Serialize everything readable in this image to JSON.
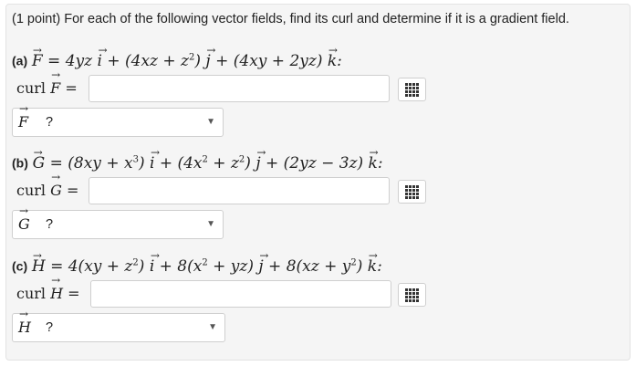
{
  "intro": "(1 point) For each of the following vector fields, find its curl and determine if it is a gradient field.",
  "curl_word": "curl",
  "parts": [
    {
      "label": "(a)",
      "field": "F",
      "expr_html": "<span class=\"vec\">F</span> = 4yz <span class=\"vec\">i</span> + (4xz + z<span class=\"up\">2</span>) <span class=\"vec\">j</span> + (4xy + 2yz) <span class=\"vec\">k</span>:",
      "selected": "?"
    },
    {
      "label": "(b)",
      "field": "G",
      "expr_html": "<span class=\"vec\">G</span> = (8xy + x<span class=\"up\">3</span>) <span class=\"vec\">i</span> + (4x<span class=\"up\">2</span> + z<span class=\"up\">2</span>) <span class=\"vec\">j</span> + (2yz − 3z) <span class=\"vec\">k</span>:",
      "selected": "?"
    },
    {
      "label": "(c)",
      "field": "H",
      "expr_html": "<span class=\"vec\">H</span> = 4(xy + z<span class=\"up\">2</span>) <span class=\"vec\">i</span> + 8(x<span class=\"up\">2</span> + yz) <span class=\"vec\">j</span> + 8(xz + y<span class=\"up\">2</span>) <span class=\"vec\">k</span>:",
      "selected": "?"
    }
  ],
  "icons": {
    "palette": "matrix-grid-icon",
    "dropdown": "caret-down-icon"
  }
}
